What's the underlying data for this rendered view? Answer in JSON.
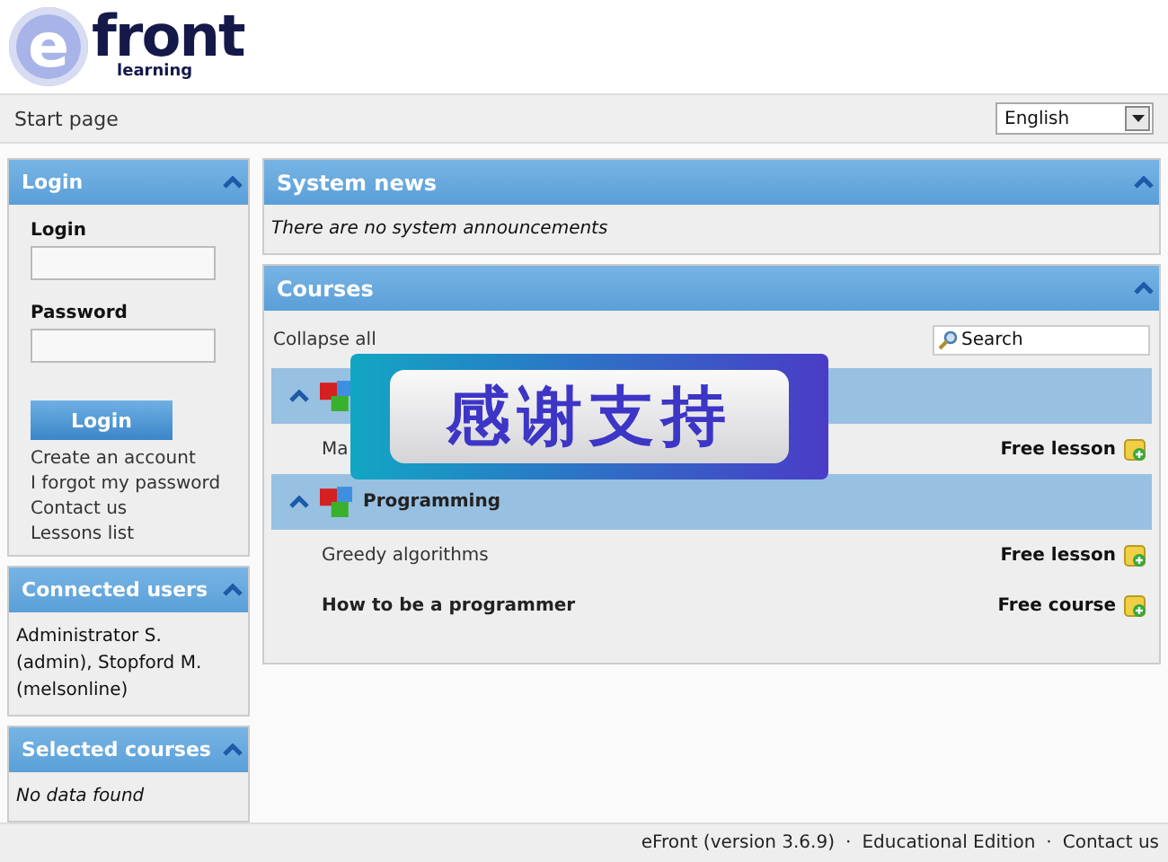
{
  "logo": {
    "letter": "e",
    "word": "front",
    "tagline": "learning"
  },
  "nav": {
    "breadcrumb": "Start page",
    "language": "English"
  },
  "login_panel": {
    "title": "Login",
    "login_label": "Login",
    "password_label": "Password",
    "button": "Login",
    "links": [
      "Create an account",
      "I forgot my password",
      "Contact us",
      "Lessons list"
    ]
  },
  "connected_users": {
    "title": "Connected users",
    "text": "Administrator S. (admin), Stopford M. (melsonline)"
  },
  "selected_courses": {
    "title": "Selected courses",
    "text": "No data found"
  },
  "system_news": {
    "title": "System news",
    "text": "There are no system announcements"
  },
  "courses": {
    "title": "Courses",
    "collapse_all": "Collapse all",
    "search_placeholder": "Search",
    "categories": [
      {
        "items": [
          {
            "name": "Ma",
            "kind": "lesson",
            "price": "Free lesson"
          }
        ]
      },
      {
        "name": "Programming",
        "items": [
          {
            "name": "Greedy algorithms",
            "kind": "lesson",
            "price": "Free lesson"
          },
          {
            "name": "How to be a programmer",
            "kind": "course",
            "price": "Free course"
          }
        ]
      }
    ]
  },
  "overlay_banner": {
    "text": "感谢支持"
  },
  "footer": {
    "separator": "·",
    "links": [
      "eFront (version 3.6.9)",
      "Educational Edition",
      "Contact us"
    ]
  }
}
